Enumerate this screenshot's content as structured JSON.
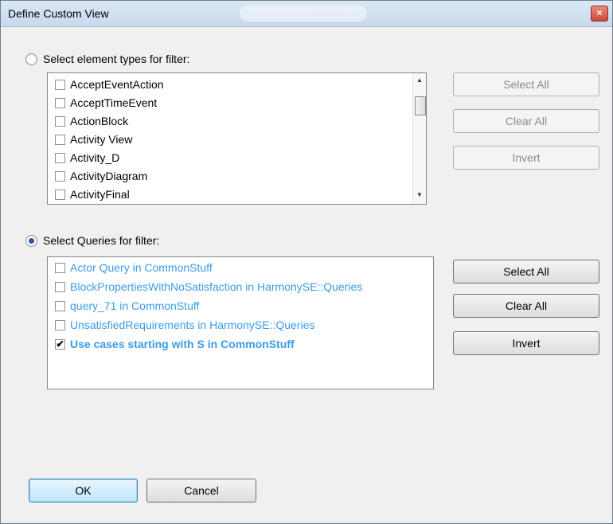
{
  "window": {
    "title": "Define Custom View",
    "close_glyph": "×"
  },
  "element_filter": {
    "radio_label": "Select element types for filter:",
    "selected": false,
    "items": [
      {
        "label": "AcceptEventAction",
        "checked": false
      },
      {
        "label": "AcceptTimeEvent",
        "checked": false
      },
      {
        "label": "ActionBlock",
        "checked": false
      },
      {
        "label": "Activity View",
        "checked": false
      },
      {
        "label": "Activity_D",
        "checked": false
      },
      {
        "label": "ActivityDiagram",
        "checked": false
      },
      {
        "label": "ActivityFinal",
        "checked": false
      }
    ],
    "buttons": {
      "select_all": "Select All",
      "clear_all": "Clear All",
      "invert": "Invert"
    },
    "buttons_enabled": false
  },
  "query_filter": {
    "radio_label": "Select Queries for filter:",
    "selected": true,
    "items": [
      {
        "label": "Actor Query in CommonStuff",
        "checked": false
      },
      {
        "label": "BlockPropertiesWithNoSatisfaction in HarmonySE::Queries",
        "checked": false
      },
      {
        "label": "query_71 in CommonStuff",
        "checked": false
      },
      {
        "label": "UnsatisfiedRequirements in HarmonySE::Queries",
        "checked": false
      },
      {
        "label": "Use cases starting with S in CommonStuff",
        "checked": true
      }
    ],
    "buttons": {
      "select_all": "Select All",
      "clear_all": "Clear All",
      "invert": "Invert"
    },
    "buttons_enabled": true
  },
  "footer": {
    "ok": "OK",
    "cancel": "Cancel"
  },
  "colors": {
    "query_text": "#3a9be8",
    "default_button_border": "#3c7fb1"
  },
  "icons": {
    "scroll_up": "▲",
    "scroll_down": "▼",
    "check": "✔"
  }
}
